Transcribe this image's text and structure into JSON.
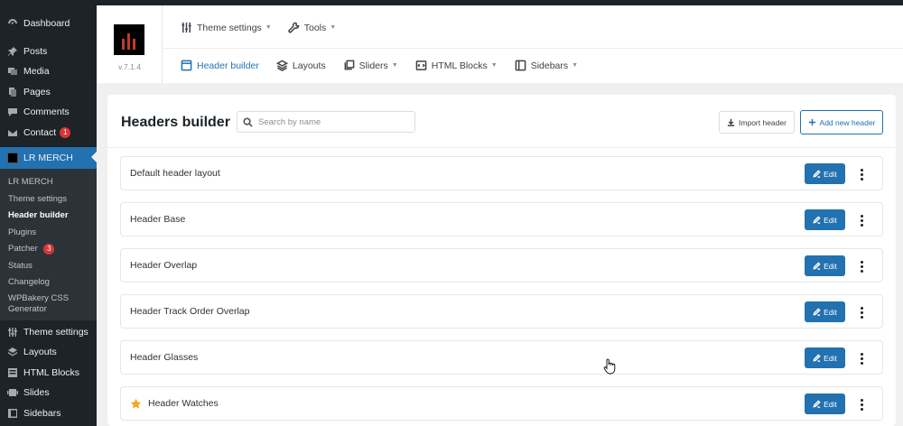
{
  "sidebar": {
    "items": [
      {
        "label": "Dashboard",
        "icon": "dashboard-icon"
      },
      {
        "label": "Posts",
        "icon": "pin-icon"
      },
      {
        "label": "Media",
        "icon": "media-icon"
      },
      {
        "label": "Pages",
        "icon": "pages-icon"
      },
      {
        "label": "Comments",
        "icon": "comment-icon"
      },
      {
        "label": "Contact",
        "icon": "mail-icon",
        "badge": "1"
      }
    ],
    "active": {
      "label": "LR MERCH"
    },
    "submenu": [
      {
        "label": "LR MERCH"
      },
      {
        "label": "Theme settings"
      },
      {
        "label": "Header builder"
      },
      {
        "label": "Plugins"
      },
      {
        "label": "Patcher",
        "badge": "3"
      },
      {
        "label": "Status"
      },
      {
        "label": "Changelog"
      },
      {
        "label": "WPBakery CSS Generator"
      }
    ],
    "bottom": [
      {
        "label": "Theme settings"
      },
      {
        "label": "Layouts"
      },
      {
        "label": "HTML Blocks"
      },
      {
        "label": "Slides"
      },
      {
        "label": "Sidebars"
      }
    ]
  },
  "topnav": {
    "version": "v.7.1.4",
    "row1": [
      {
        "label": "Theme settings",
        "icon": "sliders-icon"
      },
      {
        "label": "Tools",
        "icon": "wrench-icon"
      }
    ],
    "row2": [
      {
        "label": "Header builder",
        "icon": "browser-icon"
      },
      {
        "label": "Layouts",
        "icon": "layers-icon"
      },
      {
        "label": "Sliders",
        "icon": "slides-icon"
      },
      {
        "label": "HTML Blocks",
        "icon": "code-icon"
      },
      {
        "label": "Sidebars",
        "icon": "sidebar-icon"
      }
    ]
  },
  "main": {
    "title": "Headers builder",
    "search_placeholder": "Search by name",
    "import_label": "Import header",
    "add_label": "Add new header",
    "edit_label": "Edit",
    "headers": [
      {
        "name": "Default header layout",
        "starred": false
      },
      {
        "name": "Header Base",
        "starred": false
      },
      {
        "name": "Header Overlap",
        "starred": false
      },
      {
        "name": "Header Track Order Overlap",
        "starred": false
      },
      {
        "name": "Header Glasses",
        "starred": false
      },
      {
        "name": "Header Watches",
        "starred": true
      }
    ]
  },
  "colors": {
    "accent": "#2271b1",
    "sidebar_bg": "#1d2327",
    "star": "#f5a623"
  }
}
